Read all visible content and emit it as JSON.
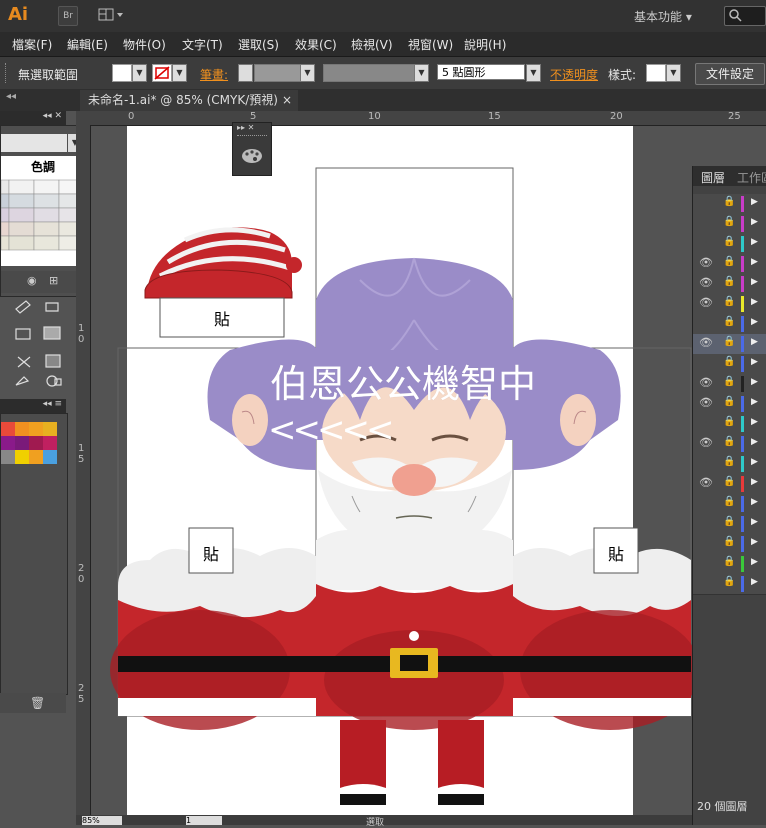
{
  "app": {
    "logo": "Ai",
    "bridge_label": "Br",
    "workspace": "基本功能"
  },
  "menu": [
    "檔案(F)",
    "編輯(E)",
    "物件(O)",
    "文字(T)",
    "選取(S)",
    "效果(C)",
    "檢視(V)",
    "視窗(W)",
    "說明(H)"
  ],
  "control": {
    "selection_status": "無選取範圍",
    "stroke_label": "筆畫:",
    "brush_label": "5 點圓形",
    "opacity_label": "不透明度",
    "style_label": "樣式:",
    "doc_setup": "文件設定"
  },
  "document": {
    "tab_title": "未命名-1.ai* @ 85% (CMYK/預視)",
    "close_glyph": "×"
  },
  "ruler_top": [
    "0",
    "5",
    "10",
    "15",
    "20",
    "25"
  ],
  "ruler_left": [
    "1\n0",
    "1\n5",
    "2\n0",
    "2\n5"
  ],
  "swatches_panel": {
    "title": "色調"
  },
  "artwork": {
    "title_text": "伯恩公公機智中",
    "arrows_text": "<<<<<",
    "paste_label": "貼"
  },
  "layers_panel": {
    "tab_layers": "圖層",
    "tab_work": "工作區",
    "count_label": "20 個圖層",
    "rows": [
      {
        "eye": false,
        "color": "#c83cc8"
      },
      {
        "eye": false,
        "color": "#c83cc8"
      },
      {
        "eye": false,
        "color": "#2ec9c9"
      },
      {
        "eye": true,
        "color": "#c83cc8"
      },
      {
        "eye": true,
        "color": "#c83cc8"
      },
      {
        "eye": true,
        "color": "#e8e82a"
      },
      {
        "eye": false,
        "color": "#4a6ae8"
      },
      {
        "eye": true,
        "color": "#4a6ae8",
        "selected": true
      },
      {
        "eye": false,
        "color": "#4a6ae8"
      },
      {
        "eye": true,
        "color": "#222222"
      },
      {
        "eye": true,
        "color": "#4a6ae8"
      },
      {
        "eye": false,
        "color": "#2ec9c9"
      },
      {
        "eye": true,
        "color": "#4a6ae8"
      },
      {
        "eye": false,
        "color": "#2ec9c9"
      },
      {
        "eye": true,
        "color": "#e83a3a"
      },
      {
        "eye": false,
        "color": "#4a6ae8"
      },
      {
        "eye": false,
        "color": "#4a6ae8"
      },
      {
        "eye": false,
        "color": "#4a6ae8"
      },
      {
        "eye": false,
        "color": "#3ac83a"
      },
      {
        "eye": false,
        "color": "#4a6ae8"
      }
    ]
  },
  "status": {
    "zoom": "85%",
    "page": "1",
    "tool": "選取"
  }
}
